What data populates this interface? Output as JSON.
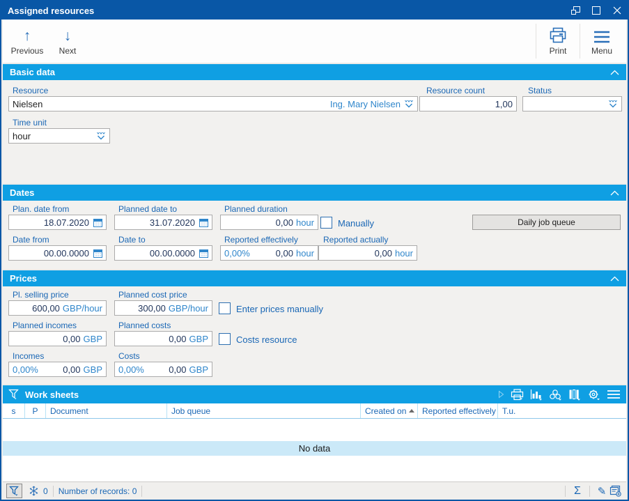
{
  "window": {
    "title": "Assigned resources"
  },
  "toolbar": {
    "previous": "Previous",
    "next": "Next",
    "print": "Print",
    "menu": "Menu"
  },
  "basic": {
    "title": "Basic data",
    "resource": {
      "label": "Resource",
      "value": "Nielsen",
      "display": "Ing. Mary Nielsen"
    },
    "resource_count": {
      "label": "Resource count",
      "value": "1,00"
    },
    "status": {
      "label": "Status",
      "value": ""
    },
    "time_unit": {
      "label": "Time unit",
      "value": "hour"
    }
  },
  "dates": {
    "title": "Dates",
    "plan_date_from": {
      "label": "Plan. date from",
      "value": "18.07.2020"
    },
    "planned_date_to": {
      "label": "Planned date to",
      "value": "31.07.2020"
    },
    "planned_duration": {
      "label": "Planned duration",
      "value": "0,00",
      "unit": "hour"
    },
    "manually": {
      "label": "Manually",
      "checked": false
    },
    "daily_job_queue": {
      "label": "Daily job queue"
    },
    "date_from": {
      "label": "Date from",
      "value": "00.00.0000"
    },
    "date_to": {
      "label": "Date to",
      "value": "00.00.0000"
    },
    "reported_effectively": {
      "label": "Reported effectively",
      "percent": "0,00%",
      "value": "0,00",
      "unit": "hour"
    },
    "reported_actually": {
      "label": "Reported actually",
      "value": "0,00",
      "unit": "hour"
    }
  },
  "prices": {
    "title": "Prices",
    "pl_selling_price": {
      "label": "Pl. selling price",
      "value": "600,00",
      "unit": "GBP/hour"
    },
    "planned_cost_price": {
      "label": "Planned cost price",
      "value": "300,00",
      "unit": "GBP/hour"
    },
    "enter_prices_manually": {
      "label": "Enter prices manually",
      "checked": false
    },
    "planned_incomes": {
      "label": "Planned incomes",
      "value": "0,00",
      "unit": "GBP"
    },
    "planned_costs": {
      "label": "Planned costs",
      "value": "0,00",
      "unit": "GBP"
    },
    "costs_resource": {
      "label": "Costs resource",
      "checked": false
    },
    "incomes": {
      "label": "Incomes",
      "percent": "0,00%",
      "value": "0,00",
      "unit": "GBP"
    },
    "costs": {
      "label": "Costs",
      "percent": "0,00%",
      "value": "0,00",
      "unit": "GBP"
    }
  },
  "worksheets": {
    "title": "Work sheets",
    "columns": [
      "s",
      "P",
      "Document",
      "Job queue",
      "Created on",
      "Reported effectively",
      "T.u."
    ],
    "sort_column": "Created on",
    "sort_direction": "ascending",
    "no_data": "No data"
  },
  "statusbar": {
    "snowflake_count": "0",
    "records": "Number of records: 0"
  },
  "colors": {
    "titlebar": "#0957a6",
    "section_header": "#0f9fe3",
    "label": "#1a67b5",
    "suffix": "#2f86cb",
    "value": "#22365c"
  }
}
